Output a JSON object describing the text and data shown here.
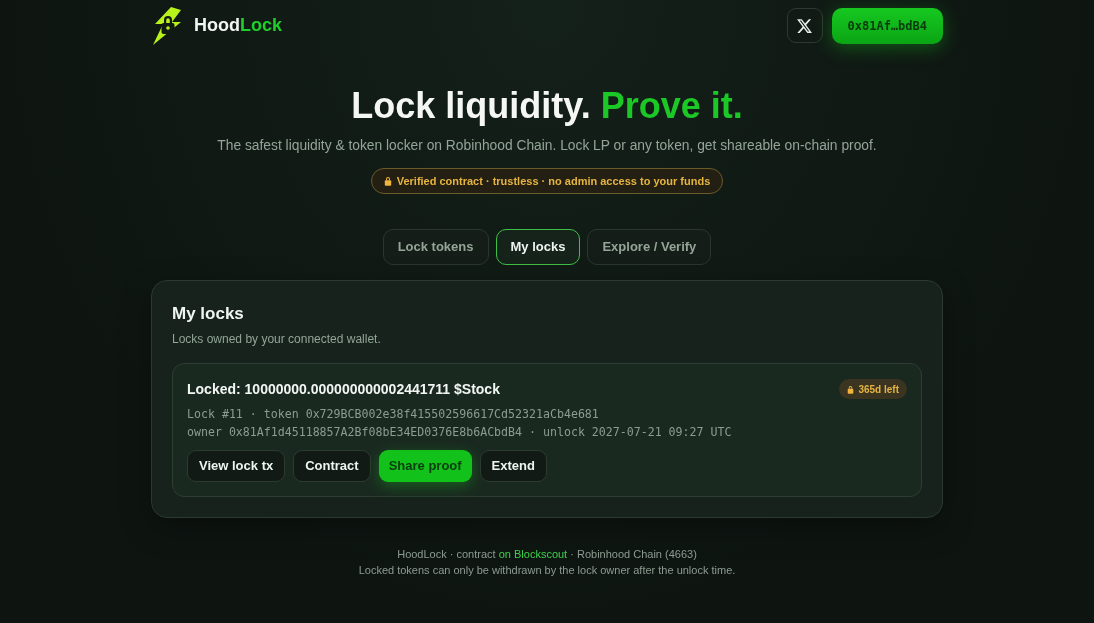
{
  "header": {
    "brand": [
      {
        "text": "Hood",
        "accent": false
      },
      {
        "text": "Lock",
        "accent": true
      }
    ],
    "wallet_button": "0x81Af…bdB4"
  },
  "hero": {
    "title": [
      {
        "text": "Lock liquidity.",
        "accent": false
      },
      {
        "text": "Prove it.",
        "accent": true
      }
    ],
    "subtitle": "The safest liquidity & token locker on Robinhood Chain. Lock LP or any token, get shareable on-chain proof.",
    "badge": "Verified contract · trustless · no admin access to your funds"
  },
  "tabs": [
    {
      "label": "Lock tokens",
      "selected": false
    },
    {
      "label": "My locks",
      "selected": true
    },
    {
      "label": "Explore / Verify",
      "selected": false
    }
  ],
  "panel": {
    "title": "My locks",
    "subtitle": "Locks owned by your connected wallet.",
    "locks": [
      {
        "title": "Locked: 10000000.000000000002441711 $Stock",
        "badge": "365d left",
        "details": [
          "Lock #11 · token 0x729BCB002e38f415502596617Cd52321aCb4e681",
          "owner 0x81Af1d45118857A2Bf08bE34ED0376E8b6ACbdB4 · unlock 2027-07-21 09:27 UTC"
        ],
        "actions": [
          {
            "label": "View lock tx",
            "kind": "secondary"
          },
          {
            "label": "Contract",
            "kind": "secondary"
          },
          {
            "label": "Share proof",
            "kind": "primary"
          },
          {
            "label": "Extend",
            "kind": "secondary"
          }
        ]
      }
    ]
  },
  "footer": {
    "credit": {
      "before": "HoodLock · contract ",
      "link": "on Blockscout",
      "after": " · Robinhood Chain (4663)"
    },
    "note": "Locked tokens can only be withdrawn by the lock owner after the unlock time."
  }
}
